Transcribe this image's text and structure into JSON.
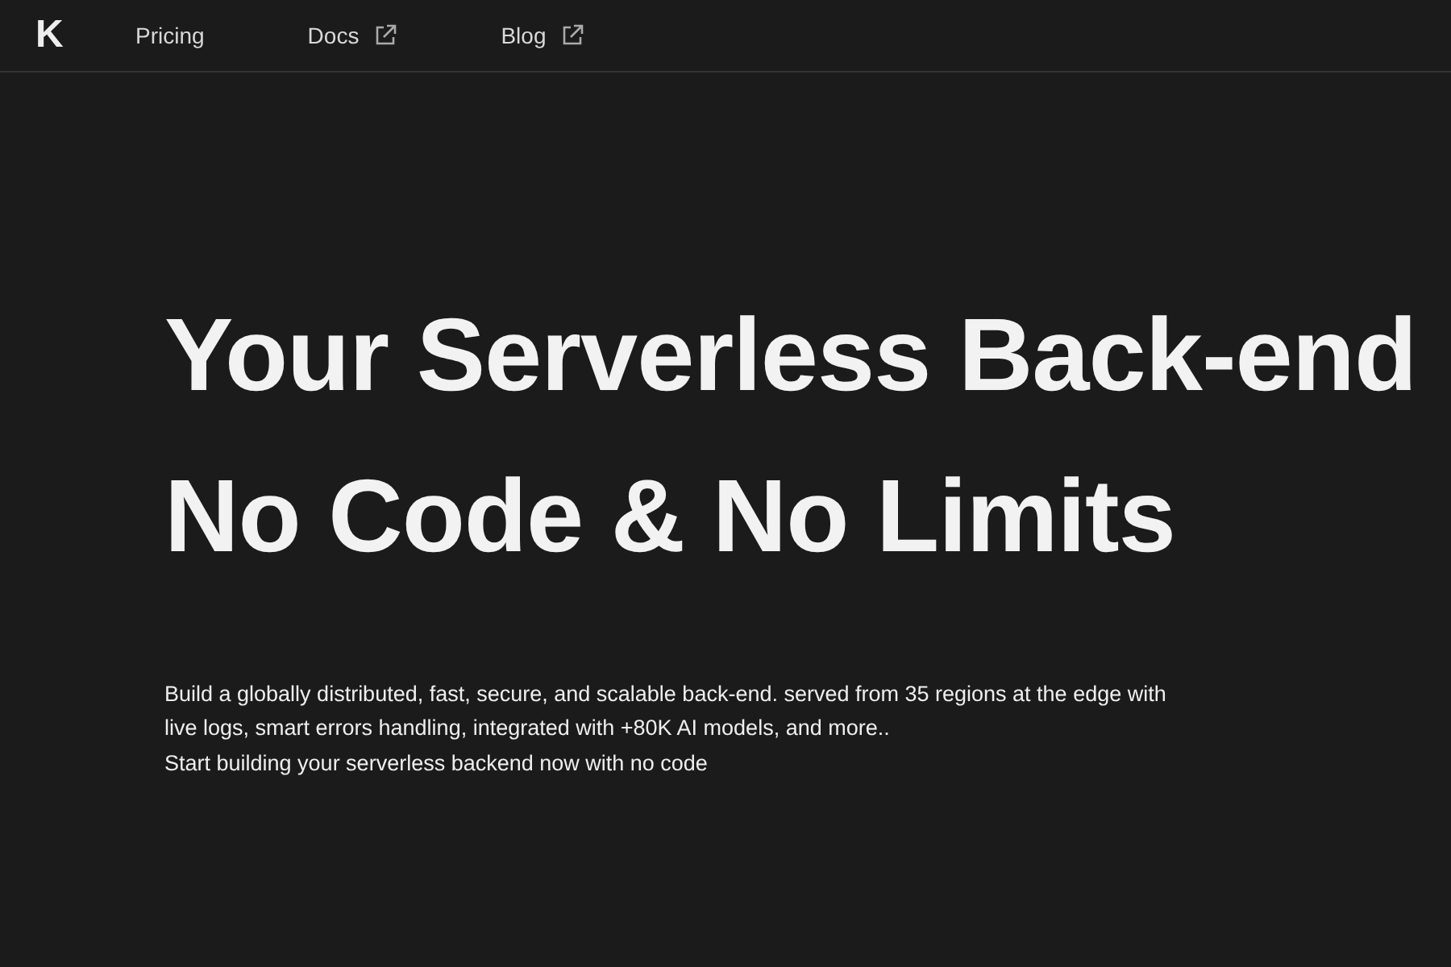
{
  "nav": {
    "logo": "K",
    "links": [
      {
        "label": "Pricing",
        "external": false
      },
      {
        "label": "Docs",
        "external": true
      },
      {
        "label": "Blog",
        "external": true
      }
    ]
  },
  "hero": {
    "title": "Your Serverless Back-end",
    "subtitle": "No Code & No Limits",
    "description": "Build a globally distributed, fast, secure, and scalable back-end. served from 35 regions at the edge with live logs, smart errors handling, integrated with +80K AI models, and more..",
    "tagline": "Start building your serverless backend now with no code"
  }
}
